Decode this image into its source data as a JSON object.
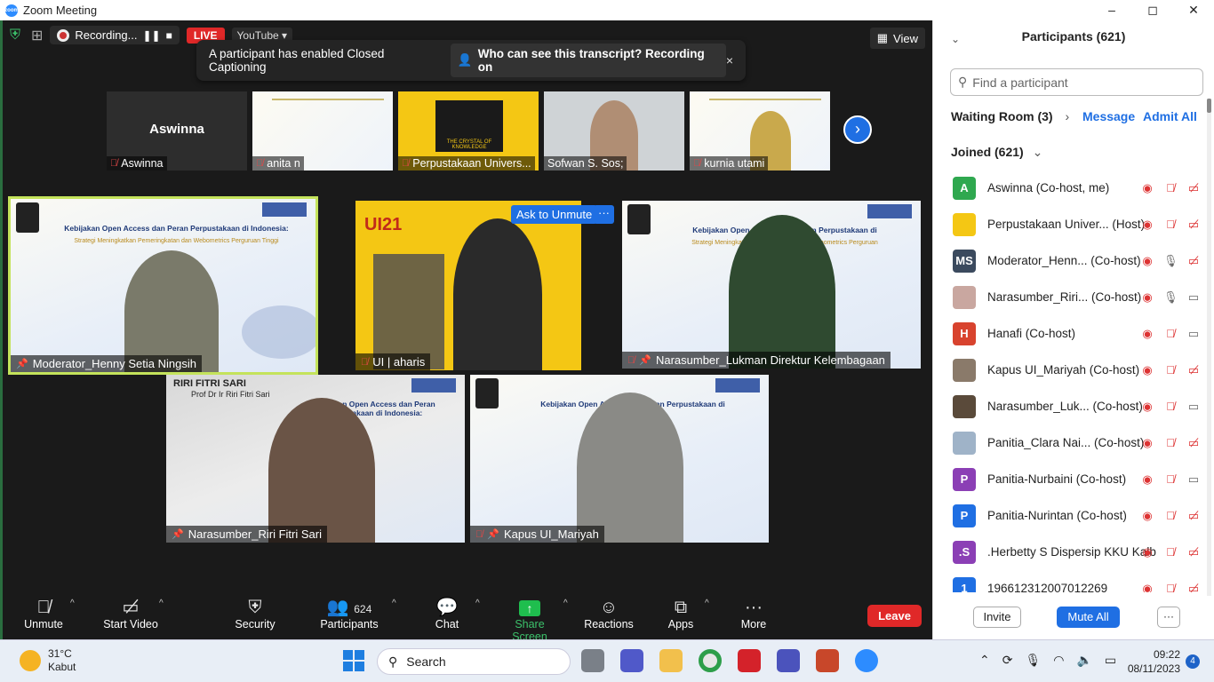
{
  "window": {
    "title": "Zoom Meeting",
    "controls": [
      "–",
      "◻",
      "✕"
    ]
  },
  "topbar": {
    "recording_label": "Recording...",
    "live_label": "LIVE",
    "youtube_label": "YouTube ▾",
    "view_label": "View"
  },
  "cc_banner": {
    "message": "A participant has enabled Closed Captioning",
    "who_label": "Who can see this transcript? Recording on",
    "close": "×"
  },
  "filmstrip": [
    {
      "name": "Aswinna",
      "big_name": "Aswinna",
      "kind": "name"
    },
    {
      "name": "anita n",
      "kind": "slide"
    },
    {
      "name": "Perpustakaan Univers...",
      "kind": "logo",
      "logo_text": "THE CRYSTAL OF KNOWLEDGE"
    },
    {
      "name": "Sofwan S. Sos;",
      "kind": "person"
    },
    {
      "name": "kurnia utami",
      "kind": "slide"
    }
  ],
  "gallery": [
    {
      "name": "Moderator_Henny Setia Ningsih",
      "slide_title": "Kebijakan Open Access dan Peran Perpustakaan di Indonesia:",
      "slide_sub": "Strategi Meningkatkan Pemeringkatan dan Webometrics Perguruan Tinggi"
    },
    {
      "name": "UI | aharis",
      "ask_unmute": "Ask to Unmute",
      "more": "···",
      "badge": "UI21"
    },
    {
      "name": "Narasumber_Lukman Direktur Kelembagaan",
      "slide_title": "Kebijakan Open Access dan Peran Perpustakaan di Indonesia:",
      "slide_sub": "Strategi Meningkatkan Pemeringkatan dan Webometrics Perguruan Tinggi"
    },
    {
      "name": "Narasumber_Riri Fitri Sari",
      "overlay_name": "RIRI FITRI SARI",
      "overlay_sub": "Prof Dr Ir Riri Fitri Sari",
      "slide_title": "Kebijakan Open Access dan Peran Perpustakaan di Indonesia:"
    },
    {
      "name": "Kapus UI_Mariyah",
      "slide_title": "Kebijakan Open Access dan Peran Perpustakaan di Indonesia:"
    }
  ],
  "toolbar": {
    "mute": "Unmute",
    "video": "Start Video",
    "security": "Security",
    "participants": "Participants",
    "participants_count": "624",
    "chat": "Chat",
    "share": "Share Screen",
    "reactions": "Reactions",
    "apps": "Apps",
    "more": "More",
    "leave": "Leave"
  },
  "panel": {
    "title": "Participants (621)",
    "search_placeholder": "Find a participant",
    "waiting_room": "Waiting Room (3)",
    "message": "Message",
    "admit_all": "Admit All",
    "joined": "Joined (621)",
    "invite": "Invite",
    "mute_all": "Mute All",
    "more": "···",
    "participants": [
      {
        "initials": "A",
        "color": "#2fa84f",
        "name": "Aswinna (Co-host, me)",
        "mic": "off",
        "cam": "off"
      },
      {
        "initials": "",
        "color": "#f4c714",
        "name": "Perpustakaan Univer... (Host)",
        "mic": "off",
        "cam": "off"
      },
      {
        "initials": "MS",
        "color": "#3b4a5e",
        "name": "Moderator_Henn... (Co-host)",
        "mic": "on",
        "cam": "off"
      },
      {
        "initials": "",
        "color": "#c9a7a0",
        "name": "Narasumber_Riri... (Co-host)",
        "mic": "on",
        "cam": "on"
      },
      {
        "initials": "H",
        "color": "#d8432e",
        "name": "Hanafi (Co-host)",
        "mic": "off",
        "cam": "on"
      },
      {
        "initials": "",
        "color": "#8a7a6a",
        "name": "Kapus UI_Mariyah (Co-host)",
        "mic": "off",
        "cam": "off"
      },
      {
        "initials": "",
        "color": "#5a4a3a",
        "name": "Narasumber_Luk... (Co-host)",
        "mic": "off",
        "cam": "on"
      },
      {
        "initials": "",
        "color": "#9fb3c8",
        "name": "Panitia_Clara Nai... (Co-host)",
        "mic": "off",
        "cam": "off"
      },
      {
        "initials": "P",
        "color": "#8b3fb5",
        "name": "Panitia-Nurbaini (Co-host)",
        "mic": "off",
        "cam": "on"
      },
      {
        "initials": "P",
        "color": "#1f6fe3",
        "name": "Panitia-Nurintan (Co-host)",
        "mic": "off",
        "cam": "off"
      },
      {
        "initials": ".S",
        "color": "#8b3fb5",
        "name": ".Herbetty S Dispersip KKU Kalb...",
        "mic": "off",
        "cam": "off"
      },
      {
        "initials": "1",
        "color": "#1f6fe3",
        "name": "196612312007012269",
        "mic": "off",
        "cam": "off"
      }
    ]
  },
  "taskbar": {
    "weather_temp": "31°C",
    "weather_desc": "Kabut",
    "search": "Search",
    "time": "09:22",
    "date": "08/11/2023",
    "notif_count": "4"
  }
}
